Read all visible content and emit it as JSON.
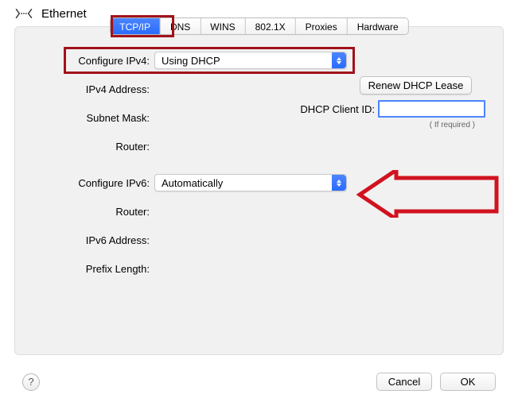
{
  "header": {
    "title": "Ethernet"
  },
  "tabs": [
    "TCP/IP",
    "DNS",
    "WINS",
    "802.1X",
    "Proxies",
    "Hardware"
  ],
  "active_tab": 0,
  "ipv4": {
    "configure_label": "Configure IPv4:",
    "configure_value": "Using DHCP",
    "address_label": "IPv4 Address:",
    "subnet_label": "Subnet Mask:",
    "router_label": "Router:"
  },
  "dhcp": {
    "renew_button": "Renew DHCP Lease",
    "client_id_label": "DHCP Client ID:",
    "client_id_value": "",
    "if_required": "( If required )"
  },
  "ipv6": {
    "configure_label": "Configure IPv6:",
    "configure_value": "Automatically",
    "router_label": "Router:",
    "address_label": "IPv6 Address:",
    "prefix_label": "Prefix Length:"
  },
  "footer": {
    "cancel": "Cancel",
    "ok": "OK"
  },
  "annotation_color": "#a1121a"
}
